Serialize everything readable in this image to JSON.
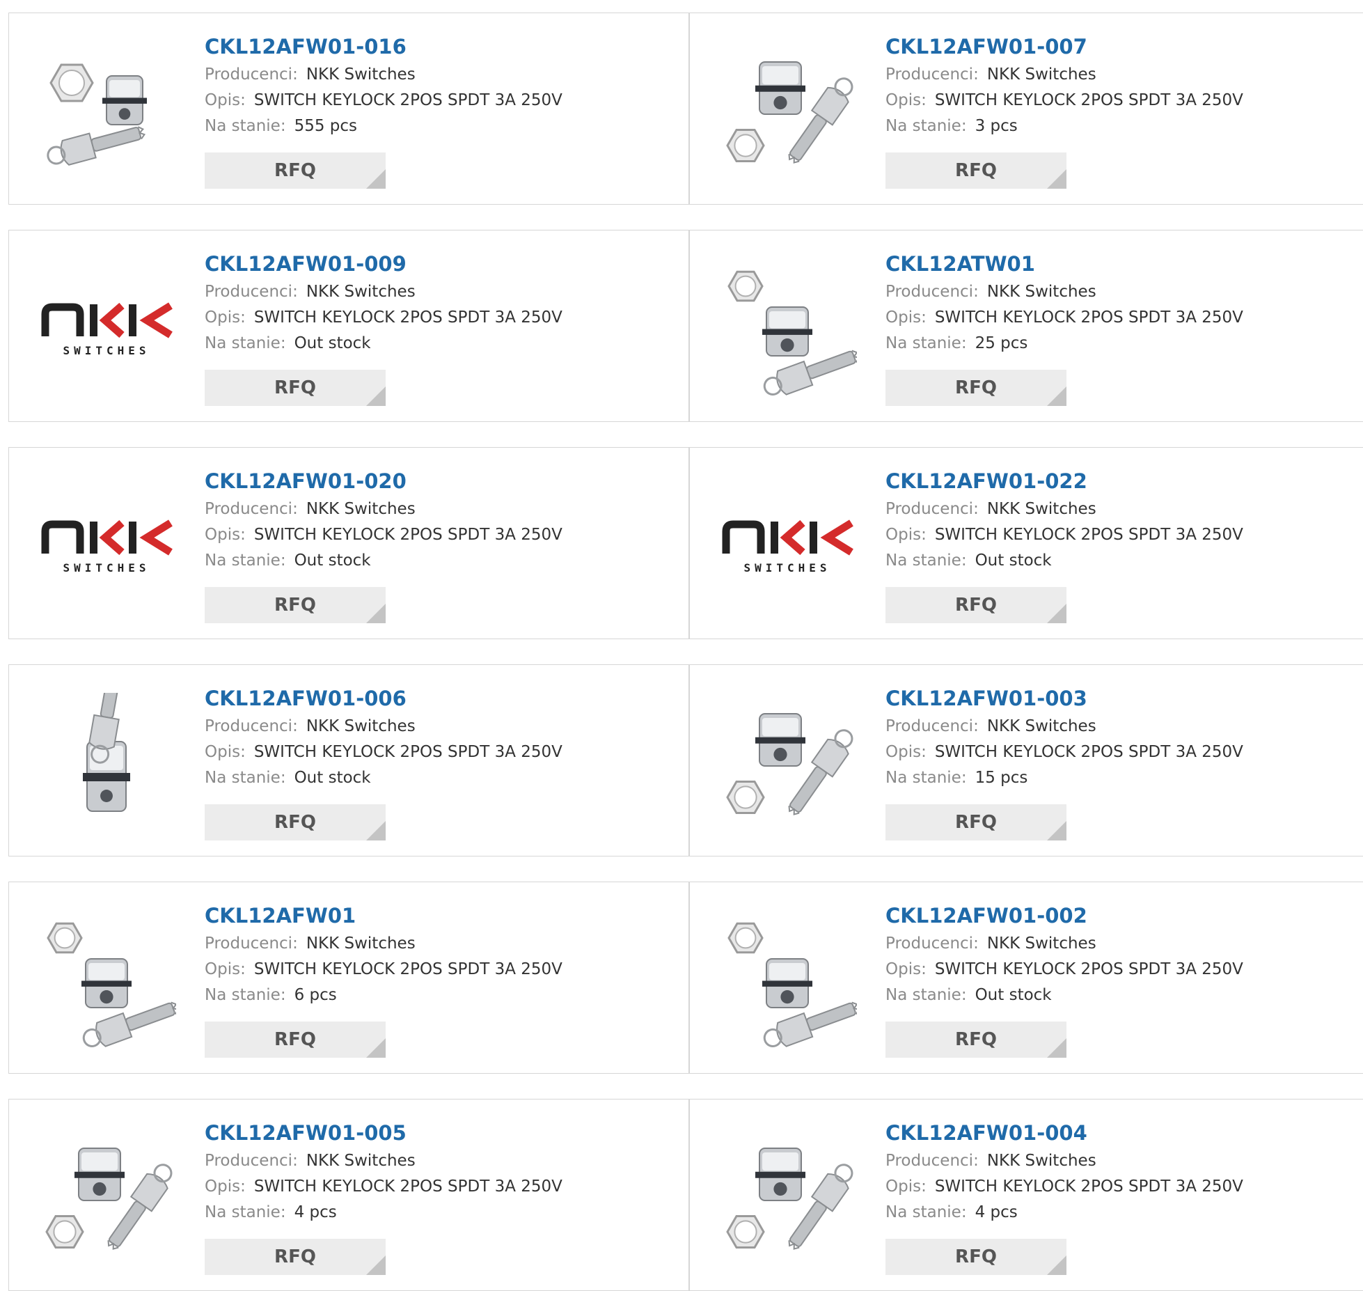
{
  "labels": {
    "manufacturer": "Producenci:",
    "description": "Opis:",
    "stock": "Na stanie:",
    "rfq": "RFQ"
  },
  "products": [
    {
      "part_number": "CKL12AFW01-016",
      "manufacturer": "NKK Switches",
      "description": "SWITCH KEYLOCK 2POS SPDT 3A 250V",
      "stock": "555 pcs",
      "image": "keylock-switch-photo-nut-left"
    },
    {
      "part_number": "CKL12AFW01-007",
      "manufacturer": "NKK Switches",
      "description": "SWITCH KEYLOCK 2POS SPDT 3A 250V",
      "stock": "3 pcs",
      "image": "keylock-switch-photo-key-right"
    },
    {
      "part_number": "CKL12AFW01-009",
      "manufacturer": "NKK Switches",
      "description": "SWITCH KEYLOCK 2POS SPDT 3A 250V",
      "stock": "Out stock",
      "image": "nkk-switches-logo"
    },
    {
      "part_number": "CKL12ATW01",
      "manufacturer": "NKK Switches",
      "description": "SWITCH KEYLOCK 2POS SPDT 3A 250V",
      "stock": "25 pcs",
      "image": "keylock-switch-photo-tubular"
    },
    {
      "part_number": "CKL12AFW01-020",
      "manufacturer": "NKK Switches",
      "description": "SWITCH KEYLOCK 2POS SPDT 3A 250V",
      "stock": "Out stock",
      "image": "nkk-switches-logo"
    },
    {
      "part_number": "CKL12AFW01-022",
      "manufacturer": "NKK Switches",
      "description": "SWITCH KEYLOCK 2POS SPDT 3A 250V",
      "stock": "Out stock",
      "image": "nkk-switches-logo"
    },
    {
      "part_number": "CKL12AFW01-006",
      "manufacturer": "NKK Switches",
      "description": "SWITCH KEYLOCK 2POS SPDT 3A 250V",
      "stock": "Out stock",
      "image": "keylock-switch-photo-vertical"
    },
    {
      "part_number": "CKL12AFW01-003",
      "manufacturer": "NKK Switches",
      "description": "SWITCH KEYLOCK 2POS SPDT 3A 250V",
      "stock": "15 pcs",
      "image": "keylock-switch-photo-key-right"
    },
    {
      "part_number": "CKL12AFW01",
      "manufacturer": "NKK Switches",
      "description": "SWITCH KEYLOCK 2POS SPDT 3A 250V",
      "stock": "6 pcs",
      "image": "keylock-switch-photo-nut-top"
    },
    {
      "part_number": "CKL12AFW01-002",
      "manufacturer": "NKK Switches",
      "description": "SWITCH KEYLOCK 2POS SPDT 3A 250V",
      "stock": "Out stock",
      "image": "keylock-switch-photo-nut-top"
    },
    {
      "part_number": "CKL12AFW01-005",
      "manufacturer": "NKK Switches",
      "description": "SWITCH KEYLOCK 2POS SPDT 3A 250V",
      "stock": "4 pcs",
      "image": "keylock-switch-photo-key-right"
    },
    {
      "part_number": "CKL12AFW01-004",
      "manufacturer": "NKK Switches",
      "description": "SWITCH KEYLOCK 2POS SPDT 3A 250V",
      "stock": "4 pcs",
      "image": "keylock-switch-photo-key-right"
    }
  ],
  "colors": {
    "part_number_link": "#1f6aa9",
    "label_gray": "#8a8a8a",
    "value_dark": "#333333",
    "rfq_bg": "#ececec",
    "card_border": "#d6d6d6",
    "logo_red": "#d42b2b",
    "logo_dark": "#222222"
  }
}
